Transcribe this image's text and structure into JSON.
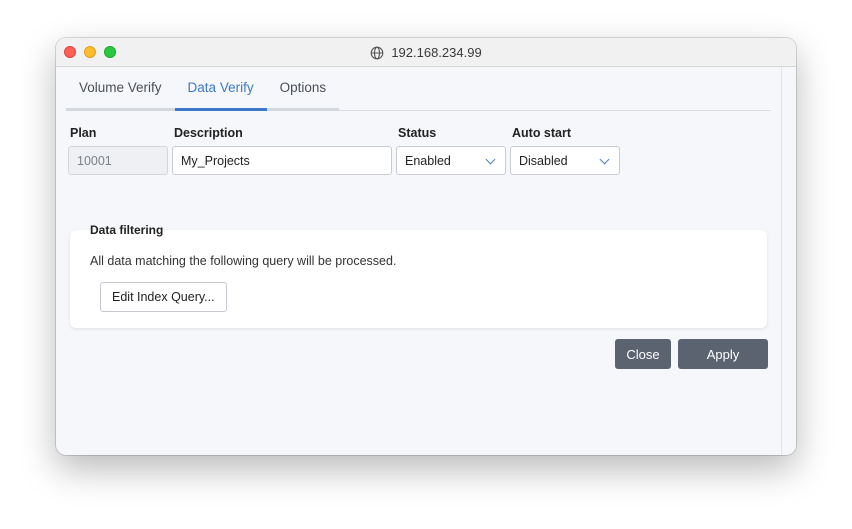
{
  "window": {
    "title": "192.168.234.99",
    "title_icon": "globe-icon"
  },
  "tabs": [
    {
      "label": "Volume Verify",
      "active": false
    },
    {
      "label": "Data Verify",
      "active": true
    },
    {
      "label": "Options",
      "active": false
    }
  ],
  "form": {
    "plan": {
      "label": "Plan",
      "value": "10001"
    },
    "description": {
      "label": "Description",
      "value": "My_Projects"
    },
    "status": {
      "label": "Status",
      "value": "Enabled"
    },
    "auto_start": {
      "label": "Auto start",
      "value": "Disabled"
    }
  },
  "data_filtering": {
    "legend": "Data filtering",
    "text": "All data matching the following query will be processed.",
    "edit_button": "Edit Index Query..."
  },
  "actions": {
    "close": "Close",
    "apply": "Apply"
  },
  "colors": {
    "accent": "#3b79c8",
    "dark_button": "#5b6370"
  }
}
